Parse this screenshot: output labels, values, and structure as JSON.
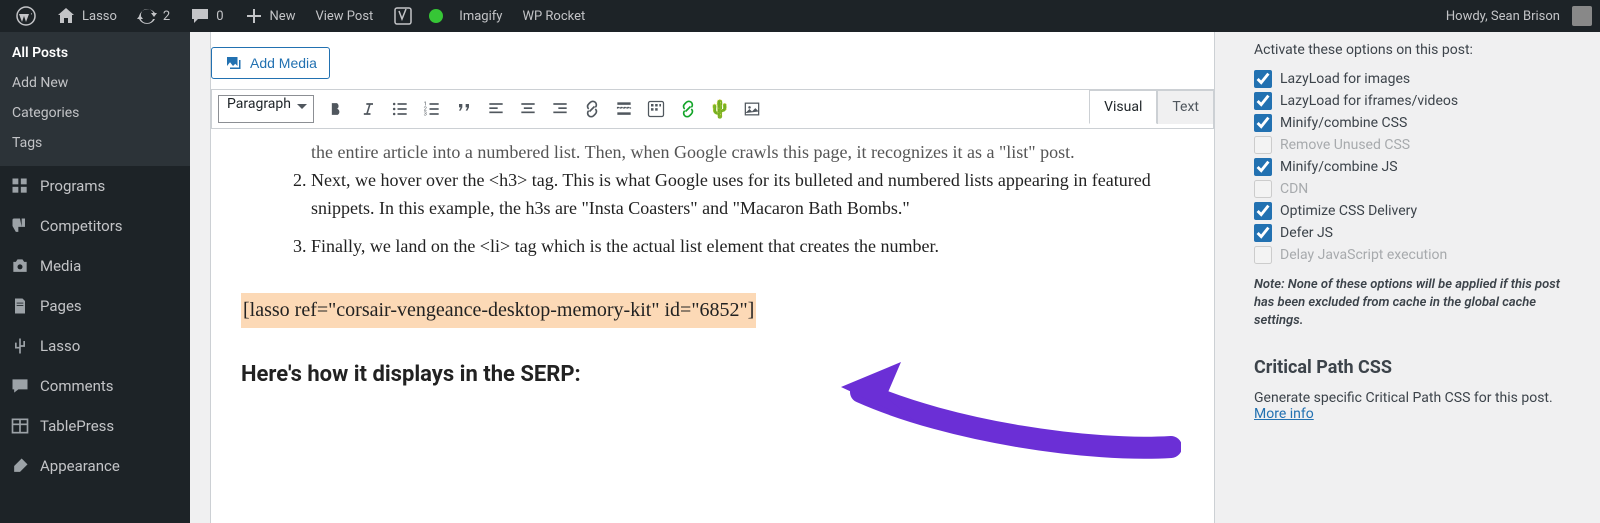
{
  "adminbar": {
    "site_name": "Lasso",
    "updates_count": "2",
    "comments_count": "0",
    "new_label": "New",
    "view_post_label": "View Post",
    "imagify_label": "Imagify",
    "wprocket_label": "WP Rocket",
    "howdy": "Howdy, Sean Brison"
  },
  "sidebar": {
    "posts_heading": "All Posts",
    "submenu": [
      "All Posts",
      "Add New",
      "Categories",
      "Tags"
    ],
    "menu": [
      {
        "label": "Programs",
        "icon": "grid"
      },
      {
        "label": "Competitors",
        "icon": "thumbs-down"
      },
      {
        "label": "Media",
        "icon": "camera"
      },
      {
        "label": "Pages",
        "icon": "page"
      },
      {
        "label": "Lasso",
        "icon": "cactus"
      },
      {
        "label": "Comments",
        "icon": "chat"
      },
      {
        "label": "TablePress",
        "icon": "table"
      },
      {
        "label": "Appearance",
        "icon": "brush"
      }
    ]
  },
  "editor": {
    "add_media_label": "Add Media",
    "tabs": {
      "visual": "Visual",
      "text": "Text"
    },
    "format_selector": "Paragraph",
    "content": {
      "cutoff": "the entire article into a numbered list. Then, when Google crawls this page, it recognizes it as a \"list\" post.",
      "li2": "Next, we hover over the <h3> tag. This is what Google uses for its bulleted and numbered lists appearing in featured snippets. In this example, the h3s are \"Insta Coasters\" and \"Macaron Bath Bombs.\"",
      "li3": "Finally, we land on the <li> tag which is the actual list element that creates the number.",
      "shortcode": "[lasso ref=\"corsair-vengeance-desktop-memory-kit\" id=\"6852\"]",
      "subhead": "Here's how it displays in the SERP:"
    }
  },
  "rsidebar": {
    "label": "Activate these options on this post:",
    "options": [
      {
        "label": "LazyLoad for images",
        "checked": true,
        "disabled": false
      },
      {
        "label": "LazyLoad for iframes/videos",
        "checked": true,
        "disabled": false
      },
      {
        "label": "Minify/combine CSS",
        "checked": true,
        "disabled": false
      },
      {
        "label": "Remove Unused CSS",
        "checked": false,
        "disabled": true
      },
      {
        "label": "Minify/combine JS",
        "checked": true,
        "disabled": false
      },
      {
        "label": "CDN",
        "checked": false,
        "disabled": true
      },
      {
        "label": "Optimize CSS Delivery",
        "checked": true,
        "disabled": false
      },
      {
        "label": "Defer JS",
        "checked": true,
        "disabled": false
      },
      {
        "label": "Delay JavaScript execution",
        "checked": false,
        "disabled": true
      }
    ],
    "note": "Note: None of these options will be applied if this post has been excluded from cache in the global cache settings.",
    "section_title": "Critical Path CSS",
    "section_text": "Generate specific Critical Path CSS for this post. ",
    "more_info": "More info"
  }
}
